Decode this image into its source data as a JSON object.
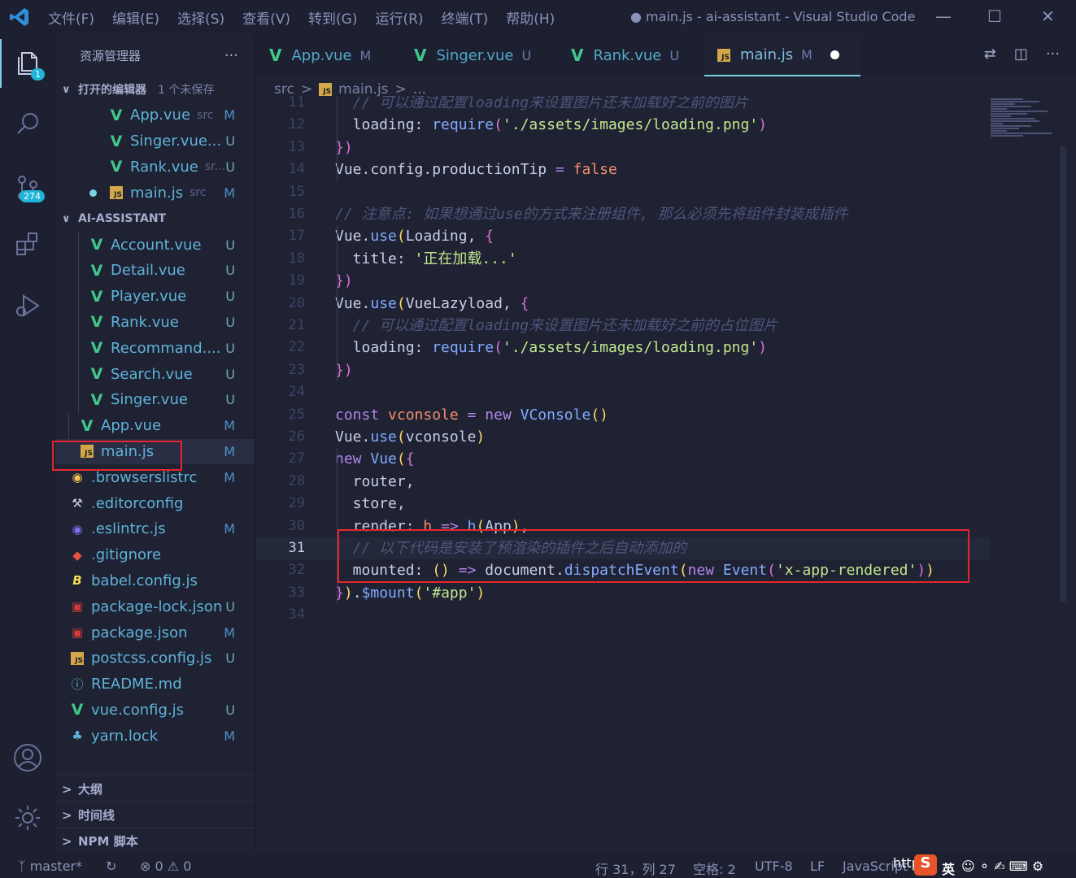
{
  "titlebar": {
    "menu": [
      "文件(F)",
      "编辑(E)",
      "选择(S)",
      "查看(V)",
      "转到(G)",
      "运行(R)",
      "终端(T)",
      "帮助(H)"
    ],
    "title": "● main.js - ai-assistant - Visual Studio Code",
    "minimize": "—",
    "maximize": "☐",
    "close": "✕"
  },
  "activity": {
    "explorer_badge": "1",
    "scm_badge": "274"
  },
  "sidebar": {
    "title": "资源管理器",
    "more": "···",
    "open_editors": {
      "title": "打开的编辑器",
      "note": "1 个未保存",
      "items": [
        {
          "name": "App.vue",
          "desc": "src",
          "status": "M",
          "icon": "vue-icon"
        },
        {
          "name": "Singer.vue...",
          "desc": "",
          "status": "U",
          "icon": "vue-icon"
        },
        {
          "name": "Rank.vue",
          "desc": "sr...",
          "status": "U",
          "icon": "vue-icon"
        },
        {
          "name": "main.js",
          "desc": "src",
          "status": "M",
          "icon": "js-icon"
        }
      ]
    },
    "project": {
      "title": "AI-ASSISTANT",
      "nested": [
        {
          "name": "Account.vue",
          "status": "U"
        },
        {
          "name": "Detail.vue",
          "status": "U"
        },
        {
          "name": "Player.vue",
          "status": "U"
        },
        {
          "name": "Rank.vue",
          "status": "U"
        },
        {
          "name": "Recommand....",
          "status": "U"
        },
        {
          "name": "Search.vue",
          "status": "U"
        },
        {
          "name": "Singer.vue",
          "status": "U"
        }
      ],
      "src_files": [
        {
          "name": "App.vue",
          "status": "M",
          "icon": "vue-icon"
        },
        {
          "name": "main.js",
          "status": "M",
          "icon": "js-icon"
        }
      ],
      "root_files": [
        {
          "name": ".browserslistrc",
          "status": "M",
          "icon": "browserslist-icon"
        },
        {
          "name": ".editorconfig",
          "status": "",
          "icon": "tools-icon"
        },
        {
          "name": ".eslintrc.js",
          "status": "M",
          "icon": "eslint-icon"
        },
        {
          "name": ".gitignore",
          "status": "",
          "icon": "git-icon"
        },
        {
          "name": "babel.config.js",
          "status": "",
          "icon": "babel-icon"
        },
        {
          "name": "package-lock.json",
          "status": "U",
          "icon": "npm-lock-icon"
        },
        {
          "name": "package.json",
          "status": "M",
          "icon": "npm-icon"
        },
        {
          "name": "postcss.config.js",
          "status": "U",
          "icon": "js-icon"
        },
        {
          "name": "README.md",
          "status": "",
          "icon": "info-icon"
        },
        {
          "name": "vue.config.js",
          "status": "U",
          "icon": "vue-icon"
        },
        {
          "name": "yarn.lock",
          "status": "M",
          "icon": "yarn-icon"
        }
      ]
    },
    "outline": "大纲",
    "timeline": "时间线",
    "npm_scripts": "NPM 脚本"
  },
  "tabs": [
    {
      "name": "App.vue",
      "status": "M",
      "icon": "vue-icon"
    },
    {
      "name": "Singer.vue",
      "status": "U",
      "icon": "vue-icon"
    },
    {
      "name": "Rank.vue",
      "status": "U",
      "icon": "vue-icon"
    },
    {
      "name": "main.js",
      "status": "M",
      "icon": "js-icon",
      "active": true
    }
  ],
  "breadcrumb": {
    "folder": "src",
    "file": "main.js",
    "more": "..."
  },
  "editor": {
    "current_line": 31,
    "lines": [
      {
        "n": 11,
        "tokens": [
          [
            "cm",
            "  // 可以通过配置loading来设置图片还未加载好之前的图片"
          ]
        ]
      },
      {
        "n": 12,
        "tokens": [
          [
            "plain",
            "  loading: "
          ],
          [
            "fn",
            "require"
          ],
          [
            "br2",
            "("
          ],
          [
            "str",
            "'./assets/images/loading.png'"
          ],
          [
            "br2",
            ")"
          ]
        ]
      },
      {
        "n": 13,
        "tokens": [
          [
            "br2",
            "})"
          ]
        ]
      },
      {
        "n": 14,
        "tokens": [
          [
            "plain",
            "Vue.config.productionTip "
          ],
          [
            "kw",
            "="
          ],
          [
            "plain",
            " "
          ],
          [
            "bool",
            "false"
          ]
        ]
      },
      {
        "n": 15,
        "tokens": []
      },
      {
        "n": 16,
        "tokens": [
          [
            "cm",
            "// 注意点: 如果想通过use的方式来注册组件, 那么必须先将组件封装成插件"
          ]
        ]
      },
      {
        "n": 17,
        "tokens": [
          [
            "plain",
            "Vue."
          ],
          [
            "fn",
            "use"
          ],
          [
            "br1",
            "("
          ],
          [
            "plain",
            "Loading, "
          ],
          [
            "br2",
            "{"
          ]
        ]
      },
      {
        "n": 18,
        "tokens": [
          [
            "plain",
            "  title: "
          ],
          [
            "str",
            "'正在加载...'"
          ]
        ]
      },
      {
        "n": 19,
        "tokens": [
          [
            "br2",
            "})"
          ]
        ]
      },
      {
        "n": 20,
        "tokens": [
          [
            "plain",
            "Vue."
          ],
          [
            "fn",
            "use"
          ],
          [
            "br1",
            "("
          ],
          [
            "plain",
            "VueLazyload, "
          ],
          [
            "br2",
            "{"
          ]
        ]
      },
      {
        "n": 21,
        "tokens": [
          [
            "cm",
            "  // 可以通过配置loading来设置图片还未加载好之前的占位图片"
          ]
        ]
      },
      {
        "n": 22,
        "tokens": [
          [
            "plain",
            "  loading: "
          ],
          [
            "fn",
            "require"
          ],
          [
            "br2",
            "("
          ],
          [
            "str",
            "'./assets/images/loading.png'"
          ],
          [
            "br2",
            ")"
          ]
        ]
      },
      {
        "n": 23,
        "tokens": [
          [
            "br2",
            "})"
          ]
        ]
      },
      {
        "n": 24,
        "tokens": []
      },
      {
        "n": 25,
        "tokens": [
          [
            "kw",
            "const"
          ],
          [
            "plain",
            " "
          ],
          [
            "var",
            "vconsole"
          ],
          [
            "plain",
            " "
          ],
          [
            "kw",
            "="
          ],
          [
            "plain",
            " "
          ],
          [
            "kw",
            "new"
          ],
          [
            "plain",
            " "
          ],
          [
            "cls",
            "VConsole"
          ],
          [
            "br1",
            "()"
          ]
        ]
      },
      {
        "n": 26,
        "tokens": [
          [
            "plain",
            "Vue."
          ],
          [
            "fn",
            "use"
          ],
          [
            "br1",
            "("
          ],
          [
            "plain",
            "vconsole"
          ],
          [
            "br1",
            ")"
          ]
        ]
      },
      {
        "n": 27,
        "tokens": [
          [
            "kw",
            "new"
          ],
          [
            "plain",
            " "
          ],
          [
            "cls",
            "Vue"
          ],
          [
            "br1",
            "("
          ],
          [
            "br2",
            "{"
          ]
        ]
      },
      {
        "n": 28,
        "tokens": [
          [
            "plain",
            "  router,"
          ]
        ]
      },
      {
        "n": 29,
        "tokens": [
          [
            "plain",
            "  store,"
          ]
        ]
      },
      {
        "n": 30,
        "tokens": [
          [
            "plain",
            "  render: "
          ],
          [
            "var",
            "h"
          ],
          [
            "plain",
            " "
          ],
          [
            "kw",
            "=>"
          ],
          [
            "plain",
            " "
          ],
          [
            "fn",
            "h"
          ],
          [
            "br1",
            "("
          ],
          [
            "plain",
            "App"
          ],
          [
            "br1",
            ")"
          ],
          [
            "plain",
            ","
          ]
        ]
      },
      {
        "n": 31,
        "tokens": [
          [
            "cm",
            "  // 以下代码是安装了预渲染的插件之后自动添加的"
          ]
        ]
      },
      {
        "n": 32,
        "tokens": [
          [
            "plain",
            "  mounted: "
          ],
          [
            "br1",
            "()"
          ],
          [
            "plain",
            " "
          ],
          [
            "kw",
            "=>"
          ],
          [
            "plain",
            " document."
          ],
          [
            "fn",
            "dispatchEvent"
          ],
          [
            "br1",
            "("
          ],
          [
            "kw",
            "new"
          ],
          [
            "plain",
            " "
          ],
          [
            "cls",
            "Event"
          ],
          [
            "br2",
            "("
          ],
          [
            "str",
            "'x-app-rendered'"
          ],
          [
            "br2",
            ")"
          ],
          [
            "br1",
            ")"
          ]
        ]
      },
      {
        "n": 33,
        "tokens": [
          [
            "br2",
            "}"
          ],
          [
            "br1",
            ")"
          ],
          [
            "plain",
            "."
          ],
          [
            "fn",
            "$mount"
          ],
          [
            "br1",
            "("
          ],
          [
            "str",
            "'#app'"
          ],
          [
            "br1",
            ")"
          ]
        ]
      },
      {
        "n": 34,
        "tokens": []
      }
    ]
  },
  "statusbar": {
    "branch": "master*",
    "errors": "0",
    "warnings": "0",
    "position": "行 31，列 27",
    "indent": "空格: 2",
    "encoding": "UTF-8",
    "eol": "LF",
    "language": "JavaScript",
    "ime_text": "http",
    "ime_lang": "英"
  },
  "colors": {
    "accent": "#7fd1e0",
    "highlight_box": "#e5262b",
    "vue_green": "#41c78a"
  }
}
